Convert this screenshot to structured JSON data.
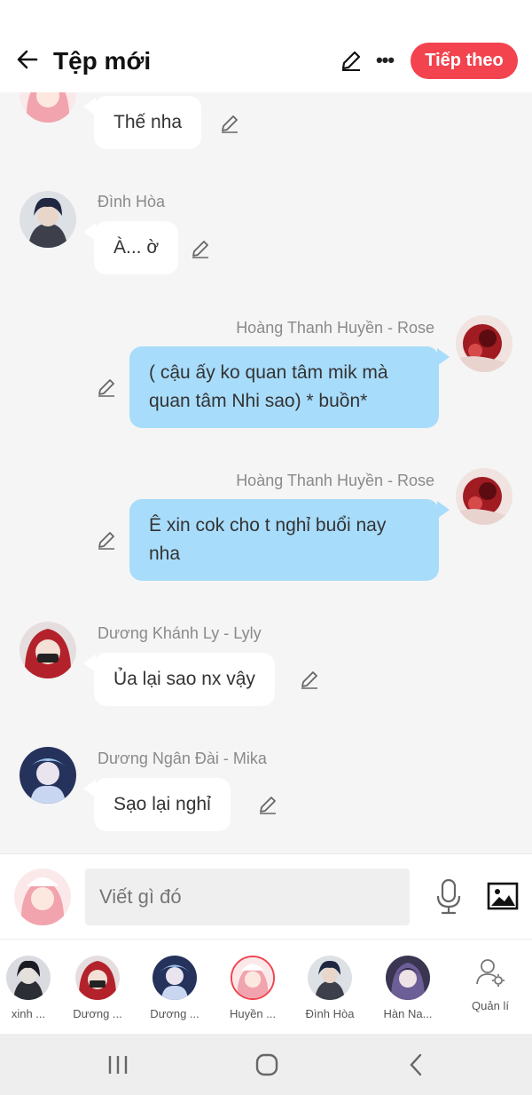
{
  "header": {
    "title": "Tệp mới",
    "next_label": "Tiếp theo",
    "more_label": "•••",
    "accent_color": "#f2434f"
  },
  "messages": [
    {
      "sender": "",
      "text": "Thế nha",
      "side": "left",
      "avatar": "pink-hair-girl"
    },
    {
      "sender": "Đình Hòa",
      "text": "À... ờ",
      "side": "left",
      "avatar": "dark-hair-boy"
    },
    {
      "sender": "Hoàng Thanh Huyền - Rose",
      "text": "( cậu ấy ko quan tâm mik mà quan tâm Nhi sao) * buồn*",
      "side": "right",
      "avatar": "red-rose"
    },
    {
      "sender": "Hoàng Thanh Huyền - Rose",
      "text": "Ê xin cok cho t nghỉ buổi nay nha",
      "side": "right",
      "avatar": "red-rose"
    },
    {
      "sender": "Dương Khánh Ly - Lyly",
      "text": "Ủa lại sao nx vậy",
      "side": "left",
      "avatar": "red-hood-girl"
    },
    {
      "sender": "Dương Ngân Đài - Mika",
      "text": "Sạo lại nghỉ",
      "side": "left",
      "avatar": "blue-hair-girl"
    }
  ],
  "composer": {
    "placeholder": "Viết gì đó"
  },
  "participants": [
    {
      "name": "xinh ...",
      "avatar": "dark-hair-girl"
    },
    {
      "name": "Dương ...",
      "avatar": "red-hood-girl"
    },
    {
      "name": "Dương ...",
      "avatar": "blue-hair-girl"
    },
    {
      "name": "Huyền ...",
      "avatar": "pink-hair-girl"
    },
    {
      "name": "Đình Hòa",
      "avatar": "dark-hair-boy"
    },
    {
      "name": "Hàn Na...",
      "avatar": "purple-hair-girl"
    }
  ],
  "manage_label": "Quản lí"
}
